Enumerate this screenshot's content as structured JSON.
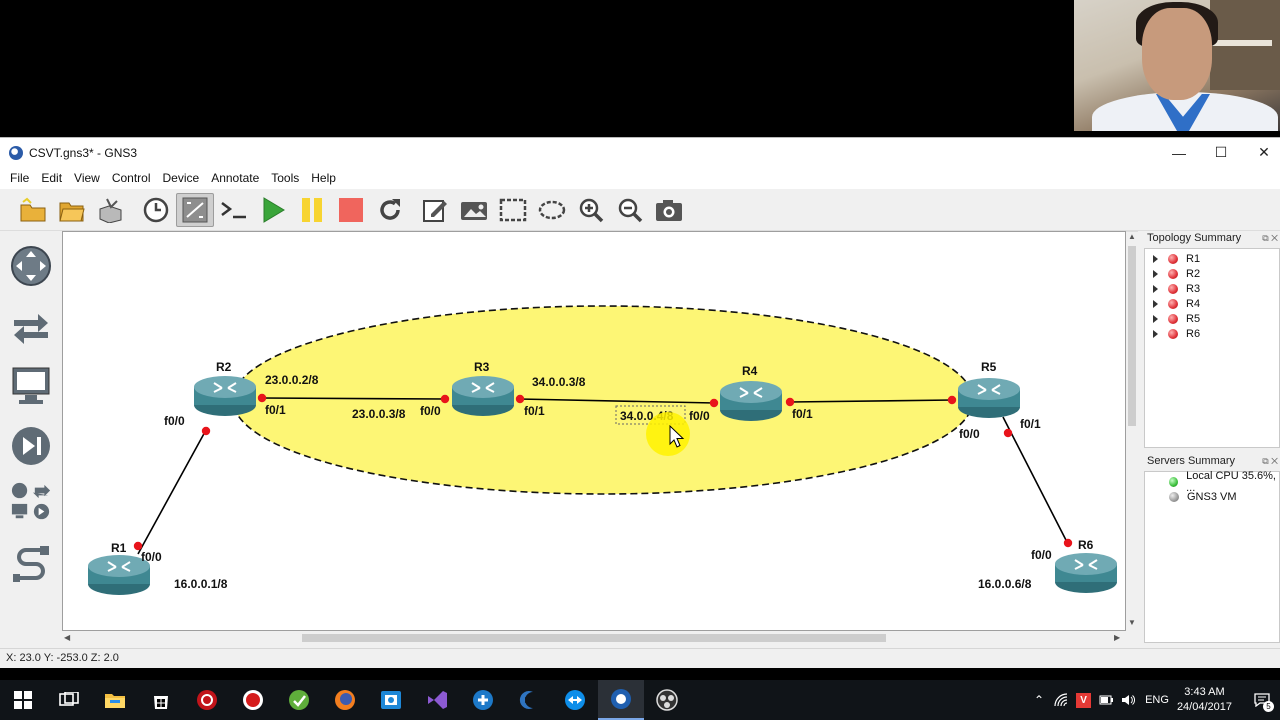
{
  "window": {
    "title": "CSVT.gns3* - GNS3",
    "minimize": "—",
    "maximize": "☐",
    "close": "✕"
  },
  "menu": [
    "File",
    "Edit",
    "View",
    "Control",
    "Device",
    "Annotate",
    "Tools",
    "Help"
  ],
  "toolbar": {
    "icons": [
      "new-project-icon",
      "open-project-icon",
      "save-project-icon",
      "snapshot-icon",
      "show-interface-labels-icon",
      "console-icon",
      "start-icon",
      "suspend-icon",
      "stop-icon",
      "reload-icon",
      "add-note-icon",
      "insert-picture-icon",
      "draw-rectangle-icon",
      "draw-ellipse-icon",
      "zoom-in-icon",
      "zoom-out-icon",
      "screenshot-icon"
    ],
    "colors": {
      "start": "#3aa53a",
      "suspend": "#f7d431",
      "stop": "#f0655d"
    }
  },
  "topology": {
    "routers": [
      {
        "name": "R1",
        "address": "16.0.0.1/8"
      },
      {
        "name": "R2",
        "address": "23.0.0.2/8"
      },
      {
        "name": "R3",
        "address": "34.0.0.3/8"
      },
      {
        "name": "R4",
        "address": "34.0.0.4/8"
      },
      {
        "name": "R5",
        "address": ""
      },
      {
        "name": "R6",
        "address": "16.0.0.6/8"
      }
    ],
    "r3_left_address": "23.0.0.3/8",
    "interfaces": {
      "r1_f00": "f0/0",
      "r2_f00": "f0/0",
      "r2_f01": "f0/1",
      "r3_f00": "f0/0",
      "r3_f01": "f0/1",
      "r4_f00": "f0/0",
      "r4_f01": "f0/1",
      "r5_f00": "f0/0",
      "r5_f01": "f0/1",
      "r6_f00": "f0/0"
    },
    "ellipse_fill": "#fdf675",
    "link_endpoint_color": "#e8141b"
  },
  "topology_summary": {
    "title": "Topology Summary",
    "nodes": [
      "R1",
      "R2",
      "R3",
      "R4",
      "R5",
      "R6"
    ]
  },
  "servers_summary": {
    "title": "Servers Summary",
    "items": [
      {
        "label": "Local CPU 35.6%, ...",
        "status": "green"
      },
      {
        "label": "GNS3 VM",
        "status": "grey"
      }
    ]
  },
  "status_bar": "X: 23.0 Y: -253.0 Z: 2.0",
  "taskbar": {
    "apps": [
      "start-icon",
      "task-view-icon",
      "file-explorer-icon",
      "store-icon",
      "app-red-icon",
      "app-record-icon",
      "app-green-icon",
      "firefox-icon",
      "outlook-icon",
      "visual-studio-icon",
      "vmware-icon",
      "eclipse-icon",
      "teamviewer-icon",
      "gns3-icon",
      "obs-icon"
    ],
    "language": "ENG",
    "time": "3:43 AM",
    "date": "24/04/2017",
    "notifications": "5"
  }
}
